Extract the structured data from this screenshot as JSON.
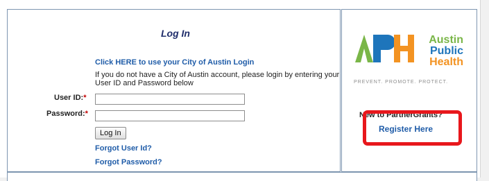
{
  "login": {
    "title": "Log In",
    "city_login_link": "Click HERE to use your City of Austin Login",
    "info_text": "If you do not have a City of Austin account, please login by entering your User ID and Password below",
    "userid_label": "User ID:",
    "password_label": "Password:",
    "required_mark": "*",
    "userid_value": "",
    "password_value": "",
    "login_button": "Log In",
    "forgot_userid": "Forgot User Id?",
    "forgot_password": "Forgot Password?"
  },
  "logo": {
    "letters": "APH",
    "line1": "Austin",
    "line2": "Public",
    "line3": "Health",
    "tagline": "PREVENT. PROMOTE. PROTECT.",
    "colors": {
      "green": "#7ab648",
      "blue": "#1e75bb",
      "orange": "#f39322"
    }
  },
  "register": {
    "prompt": "New to PartnerGrants?",
    "link": "Register Here"
  },
  "colors": {
    "link": "#1f5ca8",
    "required": "#c00000",
    "highlight": "#e8171c",
    "panel_border": "#7d95b0"
  }
}
